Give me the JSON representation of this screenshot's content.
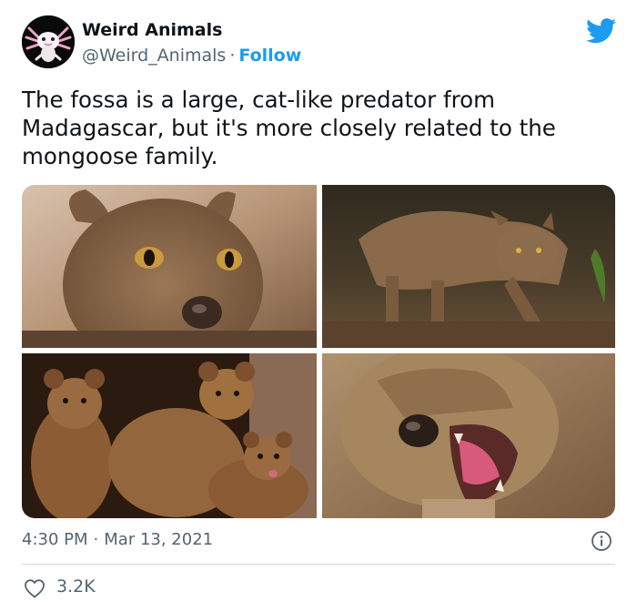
{
  "account": {
    "display_name": "Weird Animals",
    "handle": "@Weird_Animals",
    "separator": "·",
    "follow_label": "Follow",
    "avatar_icon": "axolotl-avatar",
    "follow_color": "#1d9bf0"
  },
  "tweet": {
    "text": "The fossa is a large, cat-like predator from Madagascar, but it's more closely related to the mongoose family.",
    "time": "4:30 PM",
    "separator": "·",
    "date": "Mar 13, 2021",
    "like_count": "3.2K"
  },
  "media": [
    {
      "icon": "fossa-face-closeup-photo"
    },
    {
      "icon": "fossa-walking-photo"
    },
    {
      "icon": "three-fossas-photo"
    },
    {
      "icon": "fossa-yawning-photo"
    }
  ],
  "icons": {
    "brand": "twitter-bird-icon",
    "info": "info-icon",
    "like": "heart-icon"
  },
  "colors": {
    "twitter_blue": "#1d9bf0",
    "secondary_text": "#536471",
    "primary_text": "#0f1419",
    "divider": "#cfd9de"
  }
}
